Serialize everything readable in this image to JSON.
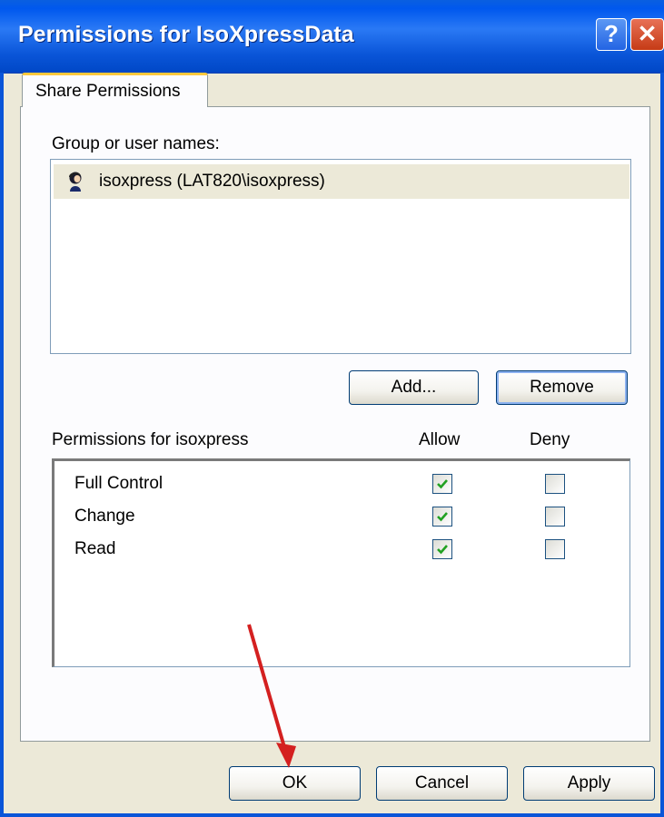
{
  "window": {
    "title": "Permissions for IsoXpressData",
    "help_label": "?",
    "close_label": "✕"
  },
  "tabs": [
    {
      "label": "Share Permissions",
      "selected": true
    }
  ],
  "group_section": {
    "label": "Group or user names:",
    "users": [
      {
        "name": "isoxpress (LAT820\\isoxpress)",
        "icon": "user-icon",
        "selected": true
      }
    ],
    "add_label": "Add...",
    "remove_label": "Remove"
  },
  "permissions": {
    "header": "Permissions for isoxpress",
    "allow_header": "Allow",
    "deny_header": "Deny",
    "rows": [
      {
        "name": "Full Control",
        "allow": true,
        "deny": false
      },
      {
        "name": "Change",
        "allow": true,
        "deny": false
      },
      {
        "name": "Read",
        "allow": true,
        "deny": false
      }
    ]
  },
  "footer": {
    "ok_label": "OK",
    "cancel_label": "Cancel",
    "apply_label": "Apply"
  },
  "colors": {
    "titlebar": "#0a55d8",
    "tab_highlight": "#ffc83c",
    "check_green": "#21a121",
    "annotation_arrow": "#d42020"
  }
}
